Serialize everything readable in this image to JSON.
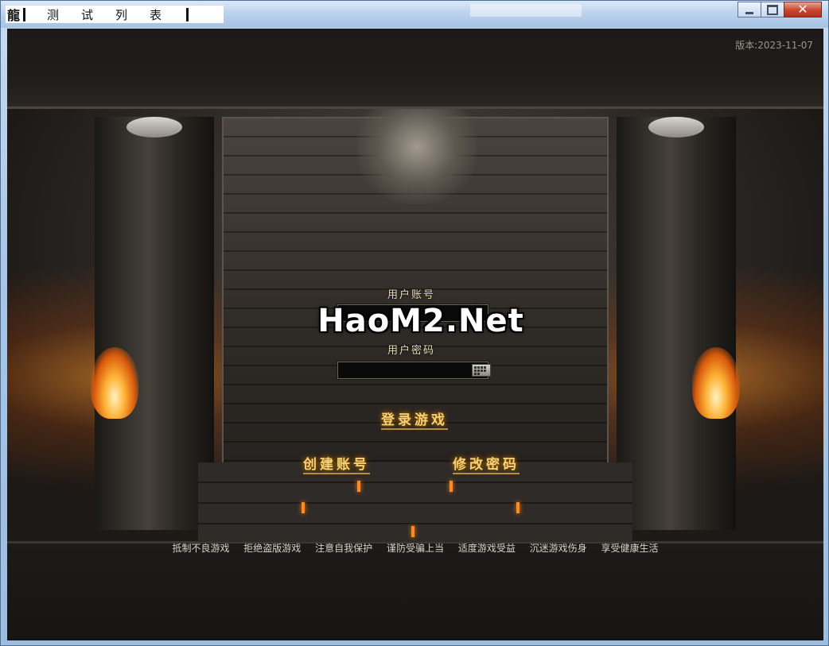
{
  "window": {
    "app_icon_glyph": "龍",
    "title_segments": [
      "测",
      "试",
      "列",
      "表"
    ],
    "controls": {
      "minimize": "minimize",
      "maximize": "maximize",
      "close": "close"
    }
  },
  "header": {
    "version": "版本:2023-11-07"
  },
  "login": {
    "username_label": "用户账号",
    "password_label": "用户密码",
    "username_value": "",
    "password_value": "",
    "watermark": "HaoM2.Net",
    "login_button": "登录游戏",
    "create_account_button": "创建账号",
    "change_password_button": "修改密码"
  },
  "footer": {
    "advice": [
      "抵制不良游戏",
      "拒绝盗版游戏",
      "注意自我保护",
      "谨防受骗上当",
      "适度游戏受益",
      "沉迷游戏伤身",
      "享受健康生活"
    ]
  },
  "colors": {
    "gold": "#f3d27a",
    "titlebar": "#b9d1ec",
    "close_red": "#c9452f"
  }
}
